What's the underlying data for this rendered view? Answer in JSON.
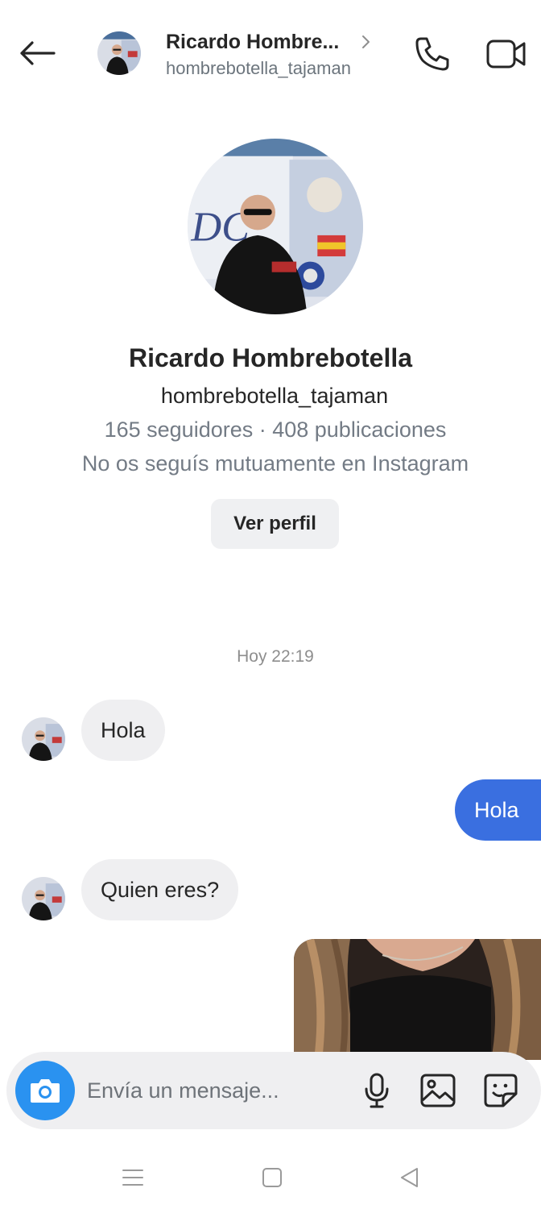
{
  "header": {
    "title": "Ricardo Hombre...",
    "username": "hombrebotella_tajaman"
  },
  "profile": {
    "name": "Ricardo Hombrebotella",
    "username": "hombrebotella_tajaman",
    "stats": "165 seguidores · 408 publicaciones",
    "mutual_note": "No os seguís mutuamente en Instagram",
    "view_profile_label": "Ver perfil"
  },
  "conversation": {
    "timestamp": "Hoy 22:19",
    "messages": [
      {
        "from": "them",
        "text": "Hola"
      },
      {
        "from": "me",
        "text": "Hola"
      },
      {
        "from": "them",
        "text": "Quien eres?"
      },
      {
        "from": "me",
        "type": "photo"
      }
    ]
  },
  "composer": {
    "placeholder": "Envía un mensaje..."
  },
  "icons": {
    "back": "arrow-left-icon",
    "call": "phone-icon",
    "video": "video-camera-icon",
    "camera": "camera-icon",
    "mic": "microphone-icon",
    "gallery": "image-icon",
    "sticker": "sticker-icon"
  },
  "colors": {
    "outgoing_bubble": "#3a6fe0",
    "incoming_bubble": "#efeff1",
    "camera_button": "#2a92f0",
    "secondary_text": "#737b85"
  }
}
